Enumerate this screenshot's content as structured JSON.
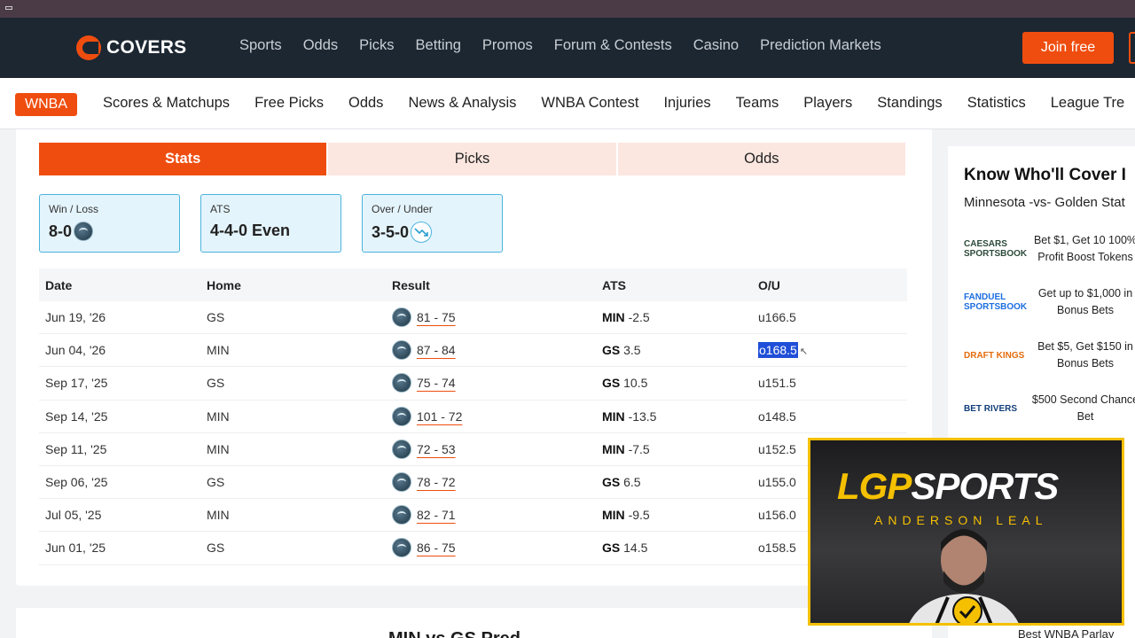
{
  "header": {
    "logo_text": "COVERS",
    "nav": [
      "Sports",
      "Odds",
      "Picks",
      "Betting",
      "Promos",
      "Forum & Contests",
      "Casino",
      "Prediction Markets"
    ],
    "join_label": "Join free"
  },
  "subnav": {
    "league": "WNBA",
    "items": [
      "Scores & Matchups",
      "Free Picks",
      "Odds",
      "News & Analysis",
      "WNBA Contest",
      "Injuries",
      "Teams",
      "Players",
      "Standings",
      "Statistics",
      "League Tre"
    ]
  },
  "tabs": [
    {
      "label": "Stats",
      "active": true
    },
    {
      "label": "Picks",
      "active": false
    },
    {
      "label": "Odds",
      "active": false
    }
  ],
  "summary": [
    {
      "label": "Win / Loss",
      "value": "8-0",
      "icon": "team-logo-icon"
    },
    {
      "label": "ATS",
      "value": "4-4-0 Even",
      "icon": ""
    },
    {
      "label": "Over / Under",
      "value": "3-5-0",
      "icon": "trend-down-icon"
    }
  ],
  "table": {
    "headers": [
      "Date",
      "Home",
      "Result",
      "ATS",
      "O/U"
    ],
    "rows": [
      {
        "date": "Jun 19, '26",
        "home": "GS",
        "result": "81 - 75",
        "ats_team": "MIN",
        "ats_line": "-2.5",
        "ou": "u166.5",
        "selected": false
      },
      {
        "date": "Jun 04, '26",
        "home": "MIN",
        "result": "87 - 84",
        "ats_team": "GS",
        "ats_line": "3.5",
        "ou": "o168.5",
        "selected": true
      },
      {
        "date": "Sep 17, '25",
        "home": "GS",
        "result": "75 - 74",
        "ats_team": "GS",
        "ats_line": "10.5",
        "ou": "u151.5",
        "selected": false
      },
      {
        "date": "Sep 14, '25",
        "home": "MIN",
        "result": "101 - 72",
        "ats_team": "MIN",
        "ats_line": "-13.5",
        "ou": "o148.5",
        "selected": false
      },
      {
        "date": "Sep 11, '25",
        "home": "MIN",
        "result": "72 - 53",
        "ats_team": "MIN",
        "ats_line": "-7.5",
        "ou": "u152.5",
        "selected": false
      },
      {
        "date": "Sep 06, '25",
        "home": "GS",
        "result": "78 - 72",
        "ats_team": "GS",
        "ats_line": "6.5",
        "ou": "u155.0",
        "selected": false
      },
      {
        "date": "Jul 05, '25",
        "home": "MIN",
        "result": "82 - 71",
        "ats_team": "MIN",
        "ats_line": "-9.5",
        "ou": "u156.0",
        "selected": false
      },
      {
        "date": "Jun 01, '25",
        "home": "GS",
        "result": "86 - 75",
        "ats_team": "GS",
        "ats_line": "14.5",
        "ou": "o158.5",
        "selected": false
      }
    ]
  },
  "next_section_heading": "MIN vs GS Pred",
  "sidebar": {
    "title": "Know Who'll Cover I",
    "matchup": "Minnesota -vs- Golden Stat",
    "offers": [
      {
        "book": "CAESARS SPORTSBOOK",
        "text": "Bet $1, Get 10 100% Profit Boost Tokens",
        "color": "#2c4a3a"
      },
      {
        "book": "FANDUEL SPORTSBOOK",
        "text": "Get up to $1,000 in Bonus Bets",
        "color": "#1d6ee0"
      },
      {
        "book": "DRAFT KINGS",
        "text": "Bet $5, Get $150 in Bonus Bets",
        "color": "#e36b0c"
      },
      {
        "book": "BET RIVERS",
        "text": "$500 Second Chance Bet",
        "color": "#123e7a"
      }
    ],
    "bottom_text": "Best WNBA Parlay"
  },
  "webcam": {
    "brand_lgp": "LGP",
    "brand_sports": "SPORTS",
    "sub": "ANDERSON LEAL"
  },
  "colors": {
    "accent": "#ef4d0f",
    "header_bg": "#1c2732",
    "selection": "#1f4fd8"
  }
}
